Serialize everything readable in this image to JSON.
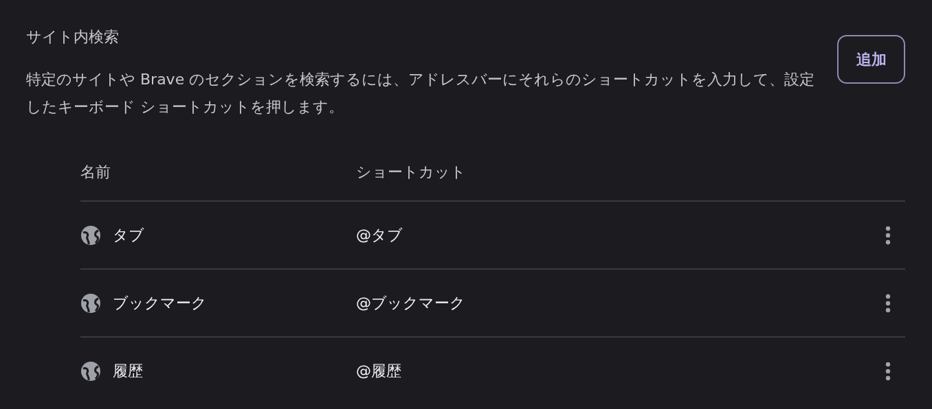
{
  "section": {
    "title": "サイト内検索",
    "description": "特定のサイトや Brave のセクションを検索するには、アドレスバーにそれらのショートカットを入力して、設定したキーボード ショートカットを押します。",
    "add_button": "追加"
  },
  "table": {
    "columns": [
      "名前",
      "ショートカット"
    ],
    "rows": [
      {
        "name": "タブ",
        "shortcut": "@タブ"
      },
      {
        "name": "ブックマーク",
        "shortcut": "@ブックマーク"
      },
      {
        "name": "履歴",
        "shortcut": "@履歴"
      }
    ]
  }
}
